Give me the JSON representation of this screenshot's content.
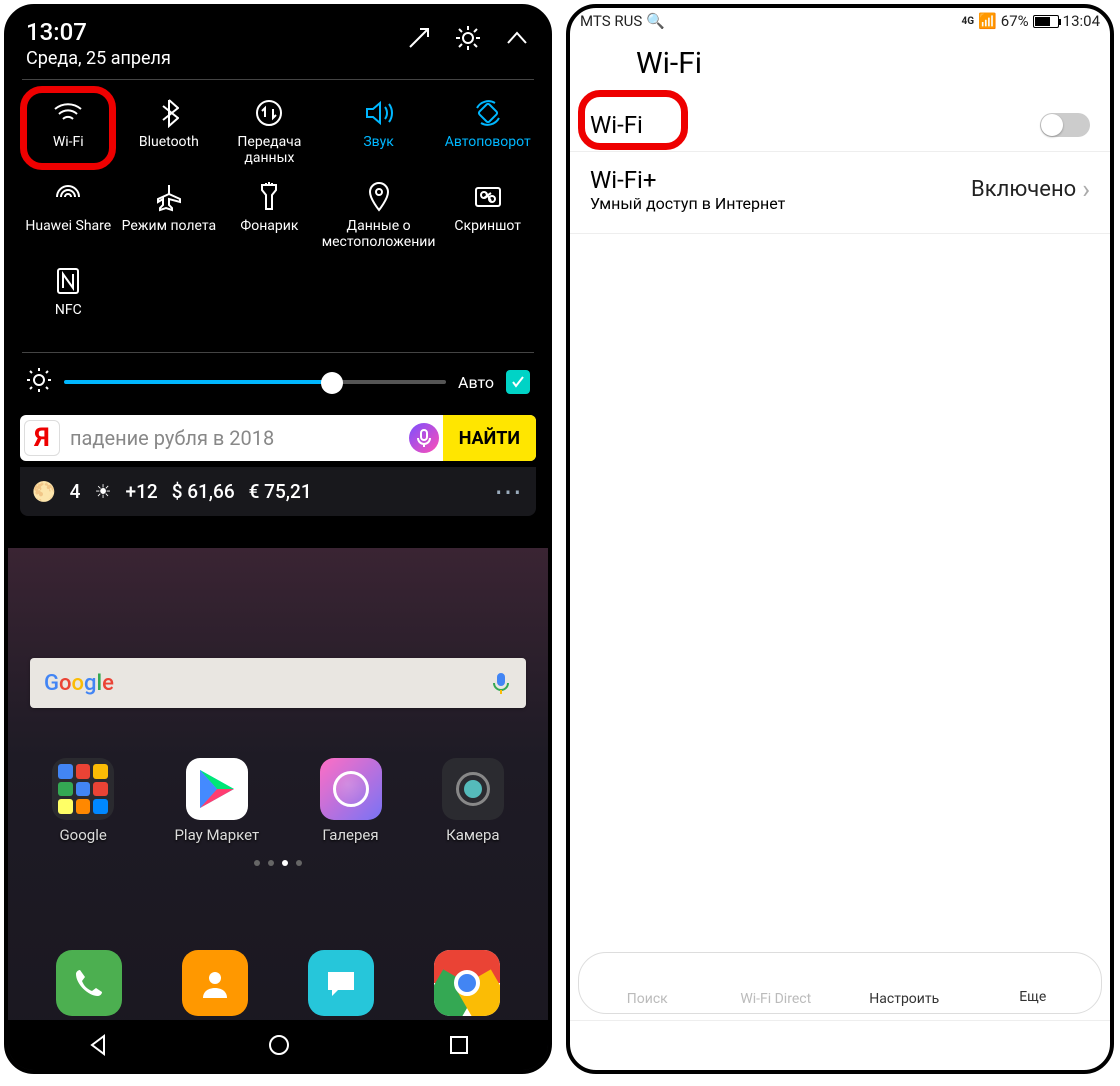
{
  "left": {
    "time": "13:07",
    "date": "Среда, 25 апреля",
    "tiles": [
      {
        "label": "Wi-Fi",
        "icon": "wifi",
        "active": false,
        "ring": true
      },
      {
        "label": "Bluetooth",
        "icon": "bluetooth",
        "active": false
      },
      {
        "label": "Передача данных",
        "icon": "data",
        "active": false
      },
      {
        "label": "Звук",
        "icon": "sound",
        "active": true
      },
      {
        "label": "Автоповорот",
        "icon": "rotate",
        "active": true
      },
      {
        "label": "Huawei Share",
        "icon": "share",
        "active": false
      },
      {
        "label": "Режим полета",
        "icon": "plane",
        "active": false
      },
      {
        "label": "Фонарик",
        "icon": "torch",
        "active": false
      },
      {
        "label": "Данные о местоположении",
        "icon": "location",
        "active": false
      },
      {
        "label": "Скриншот",
        "icon": "screenshot",
        "active": false
      },
      {
        "label": "NFC",
        "icon": "nfc",
        "active": false
      }
    ],
    "brightness": {
      "auto_label": "Авто",
      "checked": true
    },
    "search": {
      "placeholder": "падение рубля в 2018",
      "button": "НАЙТИ"
    },
    "weather": {
      "night": "4",
      "day": "+12",
      "usd": "$ 61,66",
      "eur": "€ 75,21"
    },
    "apps": [
      {
        "label": "Google"
      },
      {
        "label": "Play Маркет"
      },
      {
        "label": "Галерея"
      },
      {
        "label": "Камера"
      }
    ]
  },
  "right": {
    "carrier": "MTS RUS",
    "battery": "67%",
    "time": "13:04",
    "header": "Wi-Fi",
    "wifi_label": "Wi-Fi",
    "wifiplus": {
      "title": "Wi-Fi+",
      "subtitle": "Умный доступ в Интернет",
      "status": "Включено"
    },
    "tabs": [
      {
        "label": "Поиск",
        "icon": "refresh"
      },
      {
        "label": "Wi-Fi Direct",
        "icon": "wifidirect"
      },
      {
        "label": "Настроить",
        "icon": "gear",
        "on": true
      },
      {
        "label": "Еще",
        "icon": "more",
        "on": true
      }
    ]
  }
}
